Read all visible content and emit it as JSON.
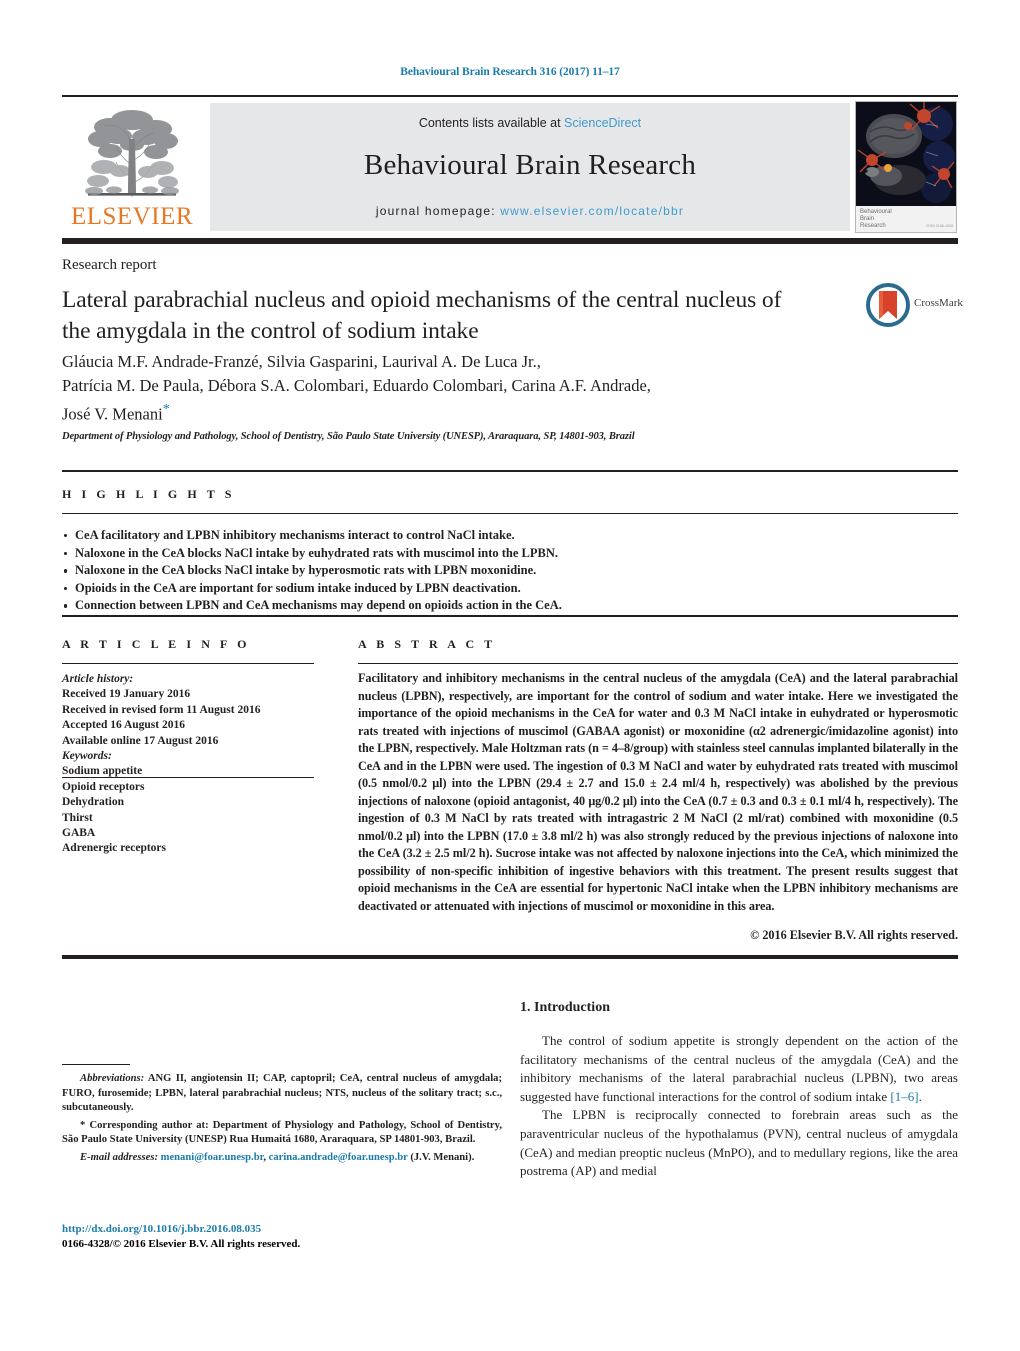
{
  "running_head": "Behavioural Brain Research 316 (2017) 11–17",
  "masthead": {
    "contents_prefix": "Contents lists available at ",
    "sciencedirect": "ScienceDirect",
    "journal_title": "Behavioural Brain Research",
    "homepage_prefix": "journal homepage: ",
    "homepage_url": "www.elsevier.com/locate/bbr",
    "publisher": "ELSEVIER",
    "cover_caption_line1": "Behavioural",
    "cover_caption_line2": "Brain",
    "cover_caption_line3": "Research",
    "cover_issn": "ISSN 0166-4328"
  },
  "article": {
    "doctype": "Research report",
    "title": "Lateral parabrachial nucleus and opioid mechanisms of the central nucleus of the amygdala in the control of sodium intake",
    "crossmark_label": "CrossMark",
    "authors_line1": "Gláucia M.F. Andrade-Franzé, Silvia Gasparini, Laurival A. De Luca Jr.,",
    "authors_line2": "Patrícia M. De Paula, Débora S.A. Colombari, Eduardo Colombari, Carina A.F. Andrade,",
    "authors_line3": "José V. Menani",
    "corresponding_marker": "*",
    "affiliation": "Department of Physiology and Pathology, School of Dentistry, São Paulo State University (UNESP), Araraquara, SP, 14801-903, Brazil"
  },
  "highlights": {
    "label": "H I G H L I G H T S",
    "items": [
      "CeA facilitatory and LPBN inhibitory mechanisms interact to control NaCl intake.",
      "Naloxone in the CeA blocks NaCl intake by euhydrated rats with muscimol into the LPBN.",
      "Naloxone in the CeA blocks NaCl intake by hyperosmotic rats with LPBN moxonidine.",
      "Opioids in the CeA are important for sodium intake induced by LPBN deactivation.",
      "Connection between LPBN and CeA mechanisms may depend on opioids action in the CeA."
    ]
  },
  "article_info": {
    "label": "A R T I C L E   I N F O",
    "history_label": "Article history:",
    "history": [
      "Received 19 January 2016",
      "Received in revised form 11 August 2016",
      "Accepted 16 August 2016",
      "Available online 17 August 2016"
    ],
    "keywords_label": "Keywords:",
    "keywords": [
      "Sodium appetite",
      "Opioid receptors",
      "Dehydration",
      "Thirst",
      "GABA",
      "Adrenergic receptors"
    ]
  },
  "abstract": {
    "label": "A B S T R A C T",
    "text": "Facilitatory and inhibitory mechanisms in the central nucleus of the amygdala (CeA) and the lateral parabrachial nucleus (LPBN), respectively, are important for the control of sodium and water intake. Here we investigated the importance of the opioid mechanisms in the CeA for water and 0.3 M NaCl intake in euhydrated or hyperosmotic rats treated with injections of muscimol (GABAA agonist) or moxonidine (α2 adrenergic/imidazoline agonist) into the LPBN, respectively. Male Holtzman rats (n = 4–8/group) with stainless steel cannulas implanted bilaterally in the CeA and in the LPBN were used. The ingestion of 0.3 M NaCl and water by euhydrated rats treated with muscimol (0.5 nmol/0.2 μl) into the LPBN (29.4 ± 2.7 and 15.0 ± 2.4 ml/4 h, respectively) was abolished by the previous injections of naloxone (opioid antagonist, 40 μg/0.2 μl) into the CeA (0.7 ± 0.3 and 0.3 ± 0.1 ml/4 h, respectively). The ingestion of 0.3 M NaCl by rats treated with intragastric 2 M NaCl (2 ml/rat) combined with moxonidine (0.5 nmol/0.2 μl) into the LPBN (17.0 ± 3.8 ml/2 h) was also strongly reduced by the previous injections of naloxone into the CeA (3.2 ± 2.5 ml/2 h). Sucrose intake was not affected by naloxone injections into the CeA, which minimized the possibility of non-specific inhibition of ingestive behaviors with this treatment. The present results suggest that opioid mechanisms in the CeA are essential for hypertonic NaCl intake when the LPBN inhibitory mechanisms are deactivated or attenuated with injections of muscimol or moxonidine in this area.",
    "copyright": "© 2016 Elsevier B.V. All rights reserved."
  },
  "introduction": {
    "heading": "1.  Introduction",
    "paragraph1_a": "The control of sodium appetite is strongly dependent on the action of the facilitatory mechanisms of the central nucleus of the amygdala (CeA) and the inhibitory mechanisms of the lateral parabrachial nucleus (LPBN), two areas suggested have functional interactions for the control of sodium intake ",
    "paragraph1_ref": "[1–6]",
    "paragraph1_b": ".",
    "paragraph2": "The LPBN is reciprocally connected to forebrain areas such as the paraventricular nucleus of the hypothalamus (PVN), central nucleus of amygdala (CeA) and median preoptic nucleus (MnPO), and to medullary regions, like the area postrema (AP) and medial"
  },
  "footnotes": {
    "abbreviations_label": "Abbreviations:",
    "abbreviations_text": " ANG II, angiotensin II; CAP, captopril; CeA, central nucleus of amygdala; FURO, furosemide; LPBN, lateral parabrachial nucleus; NTS, nucleus of the solitary tract; s.c., subcutaneously.",
    "corresponding_marker": "*",
    "corresponding_text": " Corresponding author at: Department of Physiology and Pathology, School of Dentistry, São Paulo State University (UNESP) Rua Humaitá 1680, Araraquara, SP 14801-903, Brazil.",
    "email_label": "E-mail addresses:",
    "email1": "menani@foar.unesp.br",
    "email_sep": ", ",
    "email2": "carina.andrade@foar.unesp.br",
    "email_owner": "(J.V. Menani).",
    "doi_url": "http://dx.doi.org/10.1016/j.bbr.2016.08.035",
    "issn_line": "0166-4328/© 2016 Elsevier B.V. All rights reserved."
  },
  "colors": {
    "link": "#1a7cab",
    "sciencedirect": "#3f9bcd",
    "elsevier_orange": "#e87722",
    "panel_gray": "#e6e7e8",
    "rule_black": "#231f20"
  }
}
